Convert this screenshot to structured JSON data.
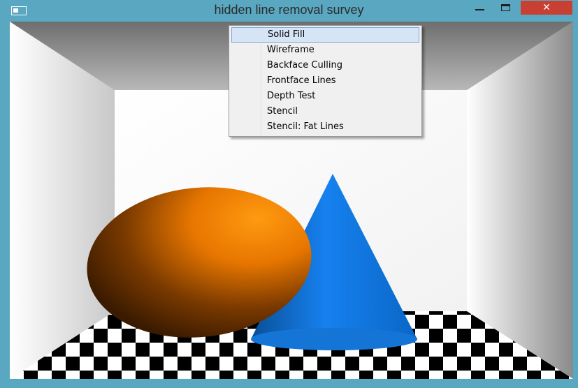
{
  "window": {
    "title": "hidden line removal survey",
    "close_label": "✕"
  },
  "menu": {
    "items": [
      {
        "label": "Solid Fill",
        "selected": true
      },
      {
        "label": "Wireframe"
      },
      {
        "label": "Backface Culling"
      },
      {
        "label": "Frontface Lines"
      },
      {
        "label": "Depth Test"
      },
      {
        "label": "Stencil"
      },
      {
        "label": "Stencil: Fat Lines"
      }
    ]
  },
  "colors": {
    "frame": "#5aa7c2",
    "sphere": "#ff8c00",
    "cone": "#1a7fe0",
    "close": "#c84031"
  }
}
